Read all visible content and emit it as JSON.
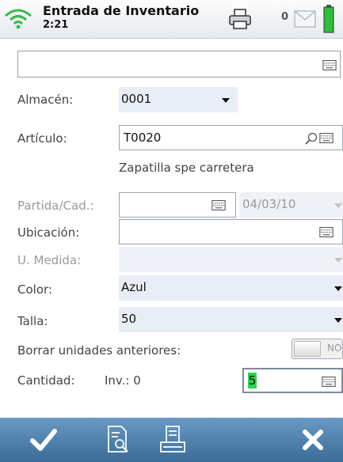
{
  "status": {
    "title": "Entrada de Inventario",
    "time": "2:21",
    "notification_count": "0"
  },
  "form": {
    "almacen_label": "Almacén:",
    "almacen_value": "0001",
    "articulo_label": "Artículo:",
    "articulo_value": "T0020",
    "articulo_description": "Zapatilla spe carretera",
    "partida_label": "Partida/Cad.:",
    "partida_value": "",
    "partida_date": "04/03/10",
    "ubicacion_label": "Ubicación:",
    "ubicacion_value": "",
    "medida_label": "U. Medida:",
    "medida_value": "",
    "color_label": "Color:",
    "color_value": "Azul",
    "talla_label": "Talla:",
    "talla_value": "50",
    "borrar_label": "Borrar unidades anteriores:",
    "borrar_toggle": "NO",
    "cantidad_label": "Cantidad:",
    "inv_label": "Inv.: 0",
    "cantidad_value": "5"
  },
  "icons": {
    "wifi": "wifi-icon",
    "printer": "printer-icon",
    "mail": "mail-icon",
    "battery": "battery-icon",
    "keyboard": "keyboard-icon",
    "search": "search-icon",
    "confirm": "check-icon",
    "list": "document-search-icon",
    "print": "print-icon",
    "cancel": "close-icon"
  },
  "colors": {
    "bottom_bar": "#4a7bab",
    "combo_bg": "#e8edf6",
    "battery": "#2fbf3a",
    "wifi": "#38b84a"
  }
}
